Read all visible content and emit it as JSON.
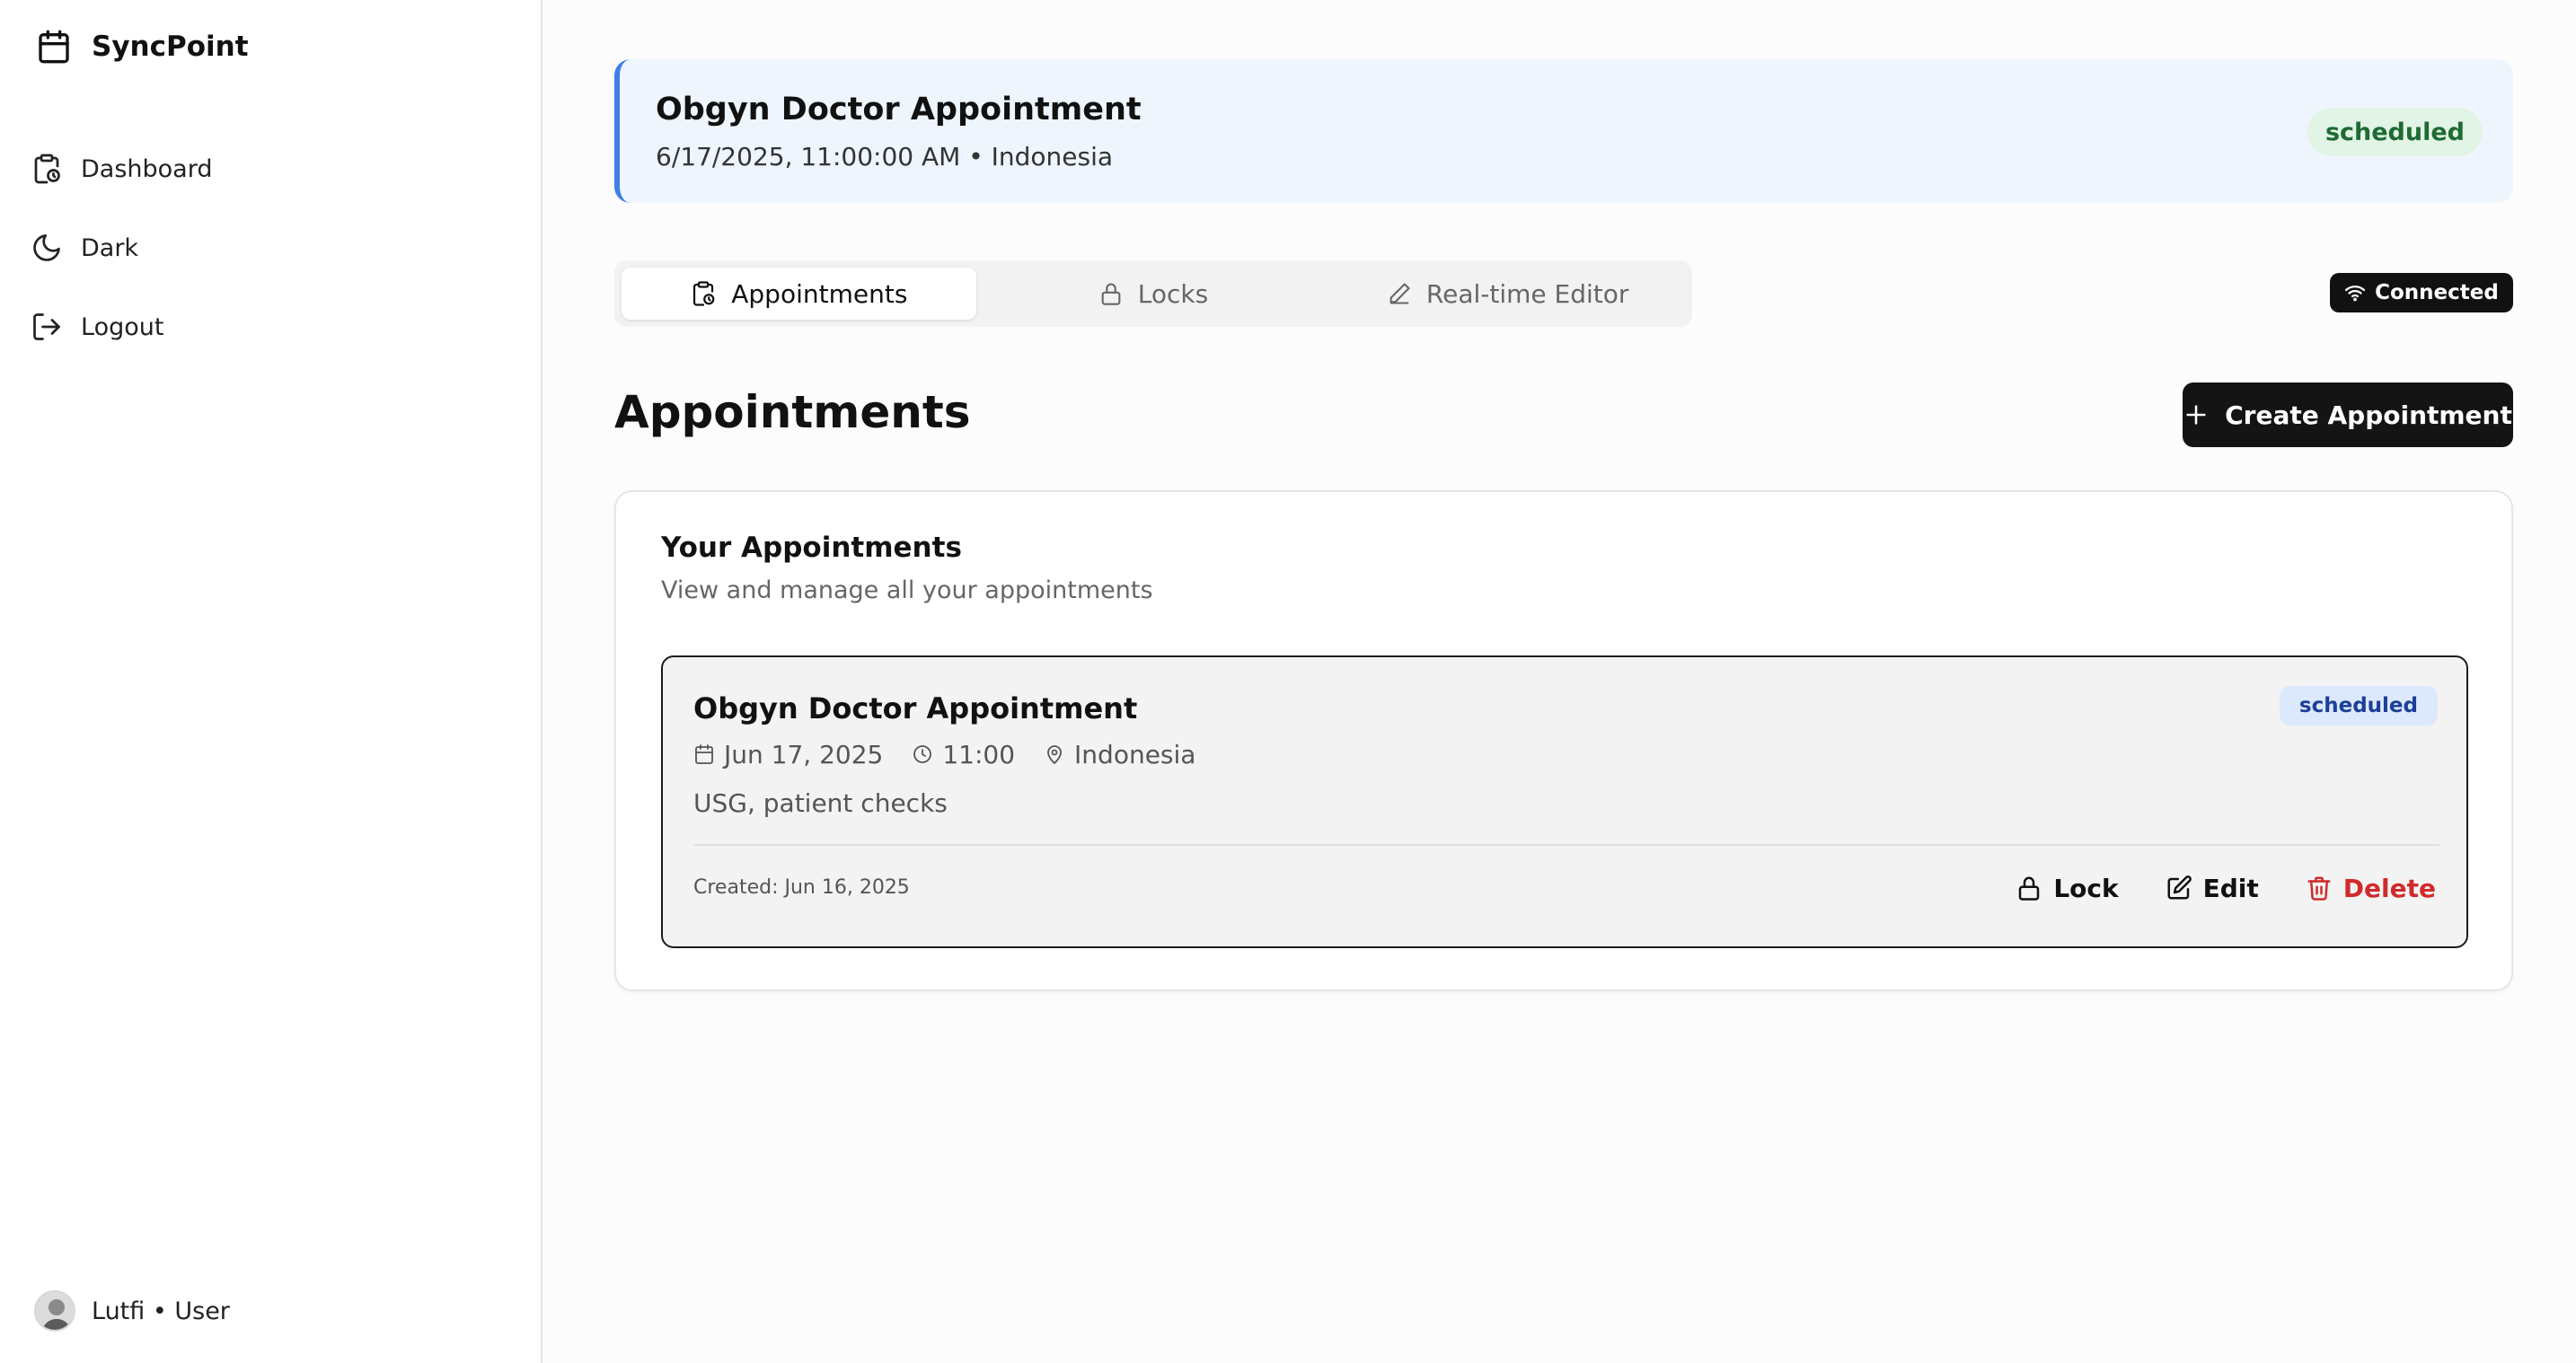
{
  "app": {
    "name": "SyncPoint"
  },
  "sidebar": {
    "items": [
      {
        "label": "Dashboard",
        "icon": "clipboard-clock-icon"
      },
      {
        "label": "Dark",
        "icon": "moon-icon"
      },
      {
        "label": "Logout",
        "icon": "logout-icon"
      }
    ],
    "user": {
      "label": "Lutfi • User"
    }
  },
  "banner": {
    "title": "Obgyn Doctor Appointment",
    "subtitle": "6/17/2025, 11:00:00 AM • Indonesia",
    "status": "scheduled"
  },
  "tabs": [
    {
      "label": "Appointments",
      "icon": "clipboard-clock-icon",
      "active": true
    },
    {
      "label": "Locks",
      "icon": "lock-icon",
      "active": false
    },
    {
      "label": "Real-time Editor",
      "icon": "pencil-icon",
      "active": false
    }
  ],
  "connection": {
    "label": "Connected",
    "icon": "wifi-icon"
  },
  "main": {
    "title": "Appointments",
    "create_label": "Create Appointment"
  },
  "panel": {
    "title": "Your Appointments",
    "subtitle": "View and manage all your appointments",
    "appointments": [
      {
        "title": "Obgyn Doctor Appointment",
        "status": "scheduled",
        "date": "Jun 17, 2025",
        "time": "11:00",
        "location": "Indonesia",
        "description": "USG, patient checks",
        "created": "Created: Jun 16, 2025",
        "actions": {
          "lock": "Lock",
          "edit": "Edit",
          "delete": "Delete"
        }
      }
    ]
  },
  "colors": {
    "accent_blue": "#3f7fe8",
    "banner_bg": "#eef5fd",
    "status_green_bg": "#e2f4e6",
    "status_green_text": "#1e6b33",
    "status_blue_bg": "#dce8fb",
    "status_blue_text": "#1d3f98",
    "danger": "#d02b2b",
    "button_dark": "#141414"
  }
}
